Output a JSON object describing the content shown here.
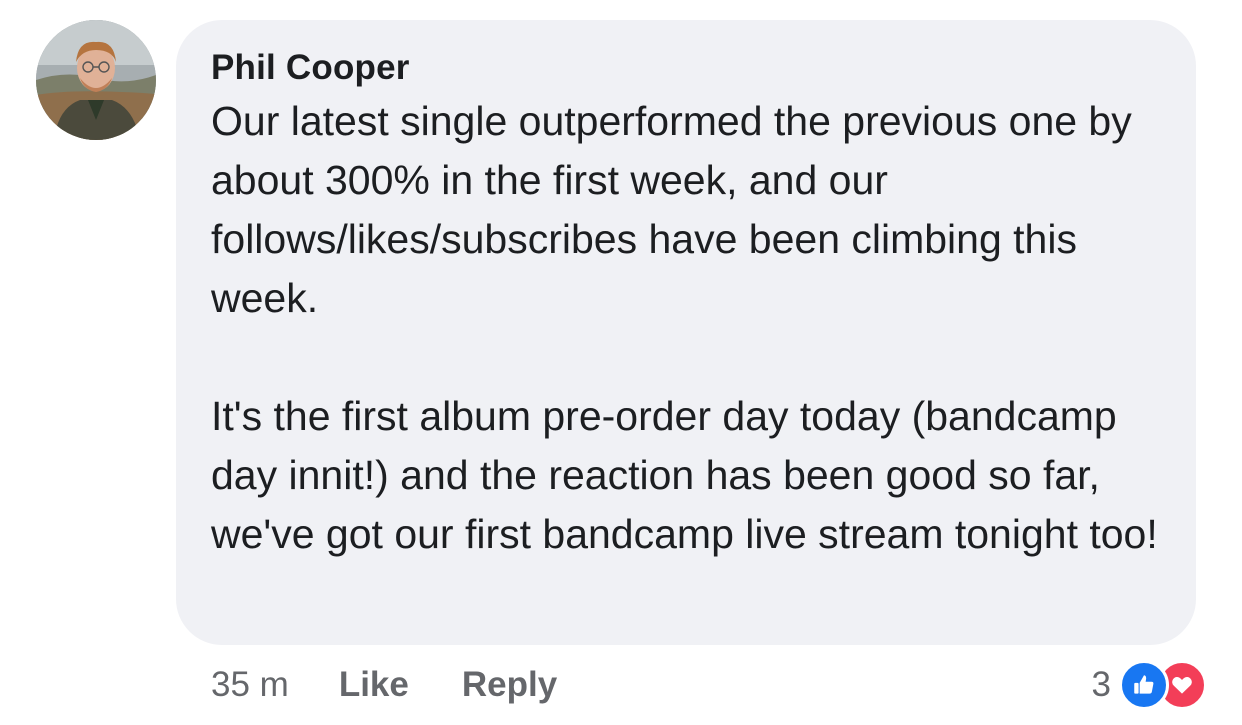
{
  "comment": {
    "author": "Phil Cooper",
    "paragraphs": [
      "Our latest single outperformed the previous one by about 300% in the first week, and our follows/likes/subscribes have been climbing this week.",
      "It's the first album pre-order day today (bandcamp day innit!) and the reaction has been good so far, we've got our first bandcamp live stream tonight too!"
    ],
    "timestamp": "35 m",
    "like_label": "Like",
    "reply_label": "Reply",
    "reaction_count": "3",
    "reaction_icons": [
      "like-icon",
      "love-icon"
    ]
  },
  "colors": {
    "bubble_bg": "#f0f1f5",
    "text": "#1c1e21",
    "muted": "#65676b",
    "like_blue": "#1877f2",
    "love_red": "#f33e58"
  }
}
